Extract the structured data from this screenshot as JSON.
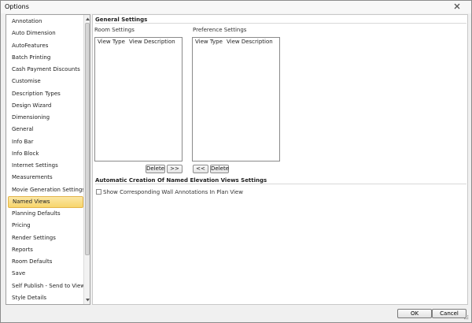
{
  "window": {
    "title": "Options"
  },
  "sidebar": {
    "items": [
      {
        "label": "Annotation"
      },
      {
        "label": "Auto Dimension"
      },
      {
        "label": "AutoFeatures"
      },
      {
        "label": "Batch Printing"
      },
      {
        "label": "Cash Payment Discounts"
      },
      {
        "label": "Customise"
      },
      {
        "label": "Description Types"
      },
      {
        "label": "Design Wizard"
      },
      {
        "label": "Dimensioning"
      },
      {
        "label": "General"
      },
      {
        "label": "Info Bar"
      },
      {
        "label": "Info Block"
      },
      {
        "label": "Internet Settings"
      },
      {
        "label": "Measurements"
      },
      {
        "label": "Movie Generation Settings"
      },
      {
        "label": "Named Views"
      },
      {
        "label": "Planning Defaults"
      },
      {
        "label": "Pricing"
      },
      {
        "label": "Render Settings"
      },
      {
        "label": "Reports"
      },
      {
        "label": "Room Defaults"
      },
      {
        "label": "Save"
      },
      {
        "label": "Self Publish - Send to Viewer"
      },
      {
        "label": "Style Details"
      }
    ],
    "selected": "Named Views"
  },
  "general": {
    "heading": "General Settings",
    "room": {
      "label": "Room Settings",
      "columns": [
        "View Type",
        "View Description"
      ],
      "delete_label": "Delete",
      "move_label": ">>"
    },
    "preference": {
      "label": "Preference Settings",
      "columns": [
        "View Type",
        "View Description"
      ],
      "move_label": "<<",
      "delete_label": "Delete"
    }
  },
  "automatic": {
    "heading": "Automatic Creation Of Named Elevation Views Settings",
    "checkbox_label": "Show Corresponding Wall Annotations In Plan View",
    "checked": false
  },
  "footer": {
    "ok_label": "OK",
    "cancel_label": "Cancel"
  },
  "colors": {
    "selected_bg": "#f7d56b",
    "selected_border": "#e3b54a"
  }
}
